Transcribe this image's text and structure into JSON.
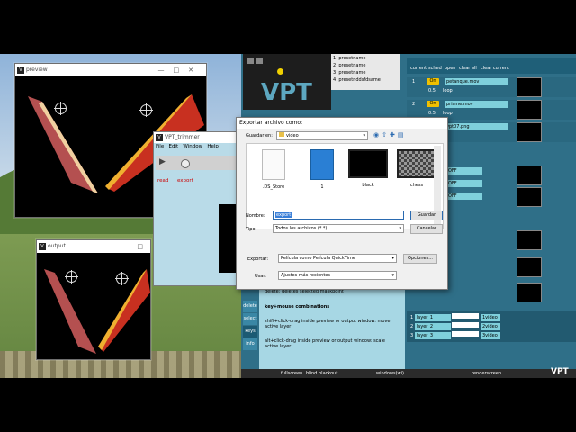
{
  "preview_window": {
    "title": "preview"
  },
  "output_window": {
    "title": "output"
  },
  "trimmer_window": {
    "title": "VPT_trimmer",
    "menu": [
      "File",
      "Edit",
      "Window",
      "Help"
    ],
    "read_label": "read",
    "export_label": "export"
  },
  "dialog": {
    "title": "Exportar archivo como:",
    "save_in_label": "Guardar en:",
    "save_in_value": "video",
    "files": [
      {
        "name": ".DS_Store",
        "kind": "doc"
      },
      {
        "name": "1",
        "kind": "movie"
      },
      {
        "name": "black",
        "kind": "film-black"
      },
      {
        "name": "chess",
        "kind": "film-chess"
      }
    ],
    "name_label": "Nombre:",
    "name_value": "export",
    "type_label": "Tipo:",
    "type_value": "Todos los archivos (*.*)",
    "save_button": "Guardar",
    "cancel_button": "Cancelar",
    "export_label": "Exportar:",
    "export_value": "Película como Película QuickTime",
    "options_button": "Opciones...",
    "use_label": "Usar:",
    "use_value": "Ajustes más recientes"
  },
  "vpt": {
    "logo": "VPT",
    "presets": [
      "presetname",
      "presetname",
      "presetname",
      "presetnddsfdsame"
    ],
    "header_buttons": [
      "current",
      "sched",
      "open",
      "clear all",
      "clear current"
    ],
    "layers": [
      {
        "num": "1",
        "on": "On",
        "file": "petanque.mov",
        "fade": "0.5",
        "mode": "loop"
      },
      {
        "num": "2",
        "on": "On",
        "file": "prisme.mov",
        "fade": "0.5",
        "mode": "loop"
      },
      {
        "file": "vpt07.png"
      }
    ],
    "off_labels": [
      "OFF",
      "OFF",
      "OFF"
    ],
    "layer_rows": [
      {
        "num": "1",
        "name": "layer_1",
        "src": "1video"
      },
      {
        "num": "2",
        "name": "layer_2",
        "src": "2video"
      },
      {
        "num": "3",
        "name": "layer_3",
        "src": "3video"
      }
    ],
    "side_tabs": [
      "delete",
      "select",
      "keys",
      "info"
    ],
    "help_title": "key+mouse combinations",
    "help_lines": [
      "delete: deletes selected maskpoint",
      "shift+click-drag inside preview or output window: move active layer",
      "alt+click-drag inside preview or output window: scale active layer"
    ],
    "bottom_labels": [
      "fullscreen",
      "blind",
      "blackout",
      "windows(wi)",
      "renderscreen"
    ]
  }
}
